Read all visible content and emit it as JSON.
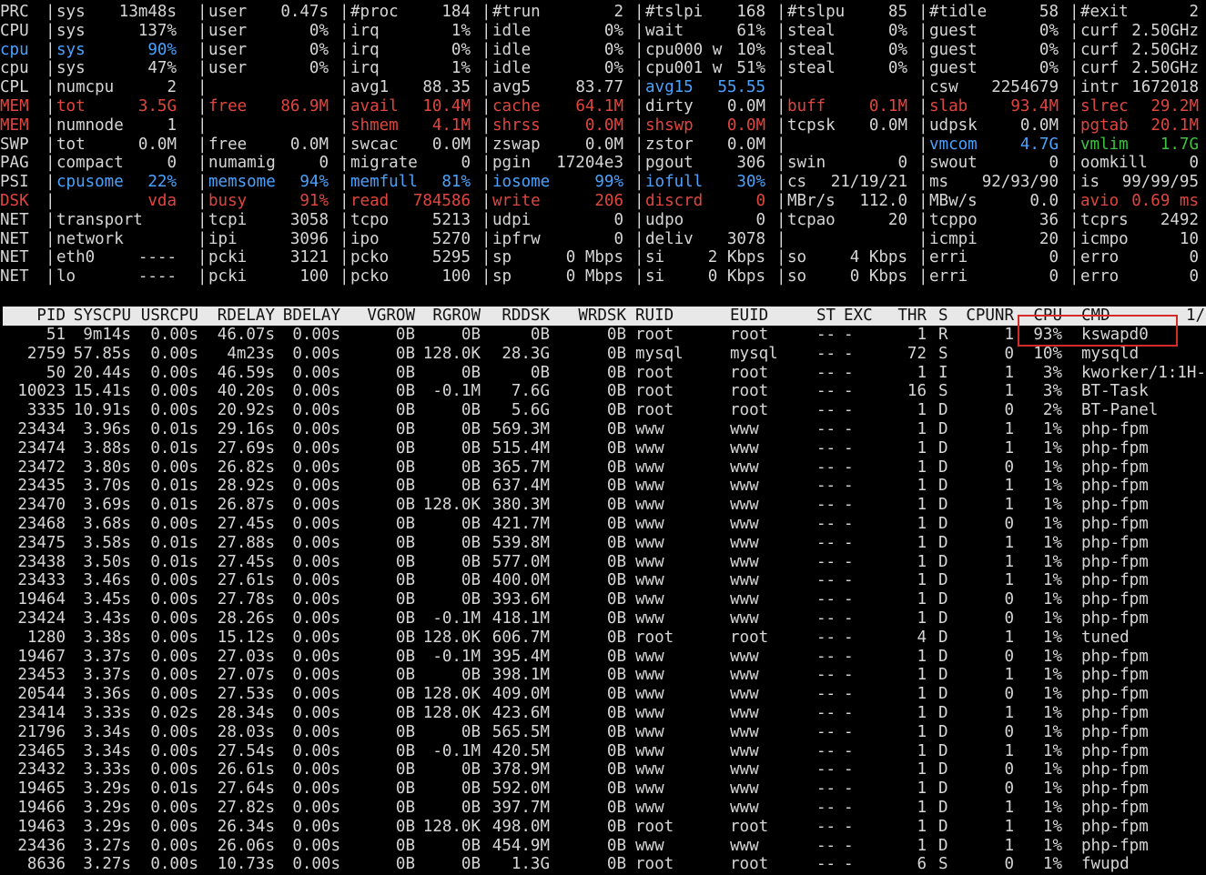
{
  "system_rows": [
    {
      "label": "PRC",
      "cells": [
        {
          "k": "sys",
          "v": "13m48s"
        },
        {
          "k": "user",
          "v": "0.47s"
        },
        {
          "k": "#proc",
          "v": "184"
        },
        {
          "k": "#trun",
          "v": "2"
        },
        {
          "k": "#tslpi",
          "v": "168"
        },
        {
          "k": "#tslpu",
          "v": "85"
        },
        {
          "k": "#tidle",
          "v": "58"
        },
        {
          "k": "#exit",
          "v": "2"
        }
      ]
    },
    {
      "label": "CPU",
      "cells": [
        {
          "k": "sys",
          "v": "137%"
        },
        {
          "k": "user",
          "v": "0%"
        },
        {
          "k": "irq",
          "v": "1%"
        },
        {
          "k": "idle",
          "v": "0%"
        },
        {
          "k": "wait",
          "v": "61%"
        },
        {
          "k": "steal",
          "v": "0%"
        },
        {
          "k": "guest",
          "v": "0%"
        },
        {
          "k": "curf",
          "v": "2.50GHz"
        }
      ]
    },
    {
      "label": "cpu",
      "color": "blue",
      "cells": [
        {
          "k": "sys",
          "v": "90%",
          "color": "blue"
        },
        {
          "k": "user",
          "v": "0%"
        },
        {
          "k": "irq",
          "v": "0%"
        },
        {
          "k": "idle",
          "v": "0%"
        },
        {
          "k": "cpu000 w",
          "v": "10%"
        },
        {
          "k": "steal",
          "v": "0%"
        },
        {
          "k": "guest",
          "v": "0%"
        },
        {
          "k": "curf",
          "v": "2.50GHz"
        }
      ]
    },
    {
      "label": "cpu",
      "cells": [
        {
          "k": "sys",
          "v": "47%"
        },
        {
          "k": "user",
          "v": "0%"
        },
        {
          "k": "irq",
          "v": "1%"
        },
        {
          "k": "idle",
          "v": "0%"
        },
        {
          "k": "cpu001 w",
          "v": "51%"
        },
        {
          "k": "steal",
          "v": "0%"
        },
        {
          "k": "guest",
          "v": "0%"
        },
        {
          "k": "curf",
          "v": "2.50GHz"
        }
      ]
    },
    {
      "label": "CPL",
      "cells": [
        {
          "k": "numcpu",
          "v": "2"
        },
        {
          "k": "",
          "v": ""
        },
        {
          "k": "avg1",
          "v": "88.35"
        },
        {
          "k": "avg5",
          "v": "83.77"
        },
        {
          "k": "avg15",
          "v": "55.55",
          "color": "blue"
        },
        {
          "k": "",
          "v": ""
        },
        {
          "k": "csw",
          "v": "2254679"
        },
        {
          "k": "intr",
          "v": "1672018"
        }
      ]
    },
    {
      "label": "MEM",
      "color": "red",
      "cells": [
        {
          "k": "tot",
          "v": "3.5G",
          "color": "red"
        },
        {
          "k": "free",
          "v": "86.9M",
          "color": "red"
        },
        {
          "k": "avail",
          "v": "10.4M",
          "color": "red"
        },
        {
          "k": "cache",
          "v": "64.1M",
          "color": "red"
        },
        {
          "k": "dirty",
          "v": "0.0M"
        },
        {
          "k": "buff",
          "v": "0.1M",
          "color": "red"
        },
        {
          "k": "slab",
          "v": "93.4M",
          "color": "red"
        },
        {
          "k": "slrec",
          "v": "29.2M",
          "color": "red"
        }
      ]
    },
    {
      "label": "MEM",
      "color": "red",
      "cells": [
        {
          "k": "numnode",
          "v": "1"
        },
        {
          "k": "",
          "v": ""
        },
        {
          "k": "shmem",
          "v": "4.1M",
          "color": "red"
        },
        {
          "k": "shrss",
          "v": "0.0M",
          "color": "red"
        },
        {
          "k": "shswp",
          "v": "0.0M",
          "color": "red"
        },
        {
          "k": "tcpsk",
          "v": "0.0M"
        },
        {
          "k": "udpsk",
          "v": "0.0M"
        },
        {
          "k": "pgtab",
          "v": "20.1M",
          "color": "red"
        }
      ]
    },
    {
      "label": "SWP",
      "cells": [
        {
          "k": "tot",
          "v": "0.0M"
        },
        {
          "k": "free",
          "v": "0.0M"
        },
        {
          "k": "swcac",
          "v": "0.0M"
        },
        {
          "k": "zswap",
          "v": "0.0M"
        },
        {
          "k": "zstor",
          "v": "0.0M"
        },
        {
          "k": "",
          "v": ""
        },
        {
          "k": "vmcom",
          "v": "4.7G",
          "color": "blue"
        },
        {
          "k": "vmlim",
          "v": "1.7G",
          "color": "green"
        }
      ]
    },
    {
      "label": "PAG",
      "cells": [
        {
          "k": "compact",
          "v": "0"
        },
        {
          "k": "numamig",
          "v": "0"
        },
        {
          "k": "migrate",
          "v": "0"
        },
        {
          "k": "pgin",
          "v": "17204e3"
        },
        {
          "k": "pgout",
          "v": "306"
        },
        {
          "k": "swin",
          "v": "0"
        },
        {
          "k": "swout",
          "v": "0"
        },
        {
          "k": "oomkill",
          "v": "0"
        }
      ]
    },
    {
      "label": "PSI",
      "cells": [
        {
          "k": "cpusome",
          "v": "22%",
          "color": "blue"
        },
        {
          "k": "memsome",
          "v": "94%",
          "color": "blue"
        },
        {
          "k": "memfull",
          "v": "81%",
          "color": "blue"
        },
        {
          "k": "iosome",
          "v": "99%",
          "color": "blue"
        },
        {
          "k": "iofull",
          "v": "30%",
          "color": "blue"
        },
        {
          "k": "cs",
          "v": "21/19/21"
        },
        {
          "k": "ms",
          "v": "92/93/90"
        },
        {
          "k": "is",
          "v": "99/99/95"
        }
      ]
    },
    {
      "label": "DSK",
      "color": "red",
      "cells": [
        {
          "k": "",
          "v": "vda",
          "color": "red"
        },
        {
          "k": "busy",
          "v": "91%",
          "color": "red"
        },
        {
          "k": "read",
          "v": "784586",
          "color": "red"
        },
        {
          "k": "write",
          "v": "206",
          "color": "red"
        },
        {
          "k": "discrd",
          "v": "0",
          "color": "red"
        },
        {
          "k": "MBr/s",
          "v": "112.0"
        },
        {
          "k": "MBw/s",
          "v": "0.0"
        },
        {
          "k": "avio",
          "v": "0.69 ms",
          "color": "red"
        }
      ]
    },
    {
      "label": "NET",
      "cells": [
        {
          "k": "transport",
          "v": ""
        },
        {
          "k": "tcpi",
          "v": "3058"
        },
        {
          "k": "tcpo",
          "v": "5213"
        },
        {
          "k": "udpi",
          "v": "0"
        },
        {
          "k": "udpo",
          "v": "0"
        },
        {
          "k": "tcpao",
          "v": "20"
        },
        {
          "k": "tcppo",
          "v": "36"
        },
        {
          "k": "tcprs",
          "v": "2492"
        }
      ]
    },
    {
      "label": "NET",
      "cells": [
        {
          "k": "network",
          "v": ""
        },
        {
          "k": "ipi",
          "v": "3096"
        },
        {
          "k": "ipo",
          "v": "5270"
        },
        {
          "k": "ipfrw",
          "v": "0"
        },
        {
          "k": "deliv",
          "v": "3078"
        },
        {
          "k": "",
          "v": ""
        },
        {
          "k": "icmpi",
          "v": "20"
        },
        {
          "k": "icmpo",
          "v": "10"
        }
      ]
    },
    {
      "label": "NET",
      "cells": [
        {
          "k": "eth0",
          "v": "----"
        },
        {
          "k": "pcki",
          "v": "3121"
        },
        {
          "k": "pcko",
          "v": "5295"
        },
        {
          "k": "sp",
          "v": "0 Mbps"
        },
        {
          "k": "si",
          "v": "2 Kbps"
        },
        {
          "k": "so",
          "v": "4 Kbps"
        },
        {
          "k": "erri",
          "v": "0"
        },
        {
          "k": "erro",
          "v": "0"
        }
      ]
    },
    {
      "label": "NET",
      "cells": [
        {
          "k": "lo",
          "v": "----"
        },
        {
          "k": "pcki",
          "v": "100"
        },
        {
          "k": "pcko",
          "v": "100"
        },
        {
          "k": "sp",
          "v": "0 Mbps"
        },
        {
          "k": "si",
          "v": "0 Kbps"
        },
        {
          "k": "so",
          "v": "0 Kbps"
        },
        {
          "k": "erri",
          "v": "0"
        },
        {
          "k": "erro",
          "v": "0"
        }
      ]
    }
  ],
  "process_header": {
    "pid": "PID",
    "syscpu": "SYSCPU",
    "usrcpu": "USRCPU",
    "rdelay": "RDELAY",
    "bdelay": "BDELAY",
    "vgrow": "VGROW",
    "rgrow": "RGROW",
    "rddsk": "RDDSK",
    "wrdsk": "WRDSK",
    "ruid": "RUID",
    "euid": "EUID",
    "st": "ST",
    "exc": "EXC",
    "thr": "THR",
    "s": "S",
    "cpunr": "CPUNR",
    "cpu": "CPU",
    "cmd": "CMD",
    "page": "1/"
  },
  "processes": [
    [
      "51",
      "9m14s",
      "0.00s",
      "46.07s",
      "0.00s",
      "0B",
      "0B",
      "0B",
      "0B",
      "root",
      "root",
      "--",
      "-",
      "1",
      "R",
      "1",
      "93%",
      "kswapd0"
    ],
    [
      "2759",
      "57.85s",
      "0.00s",
      "4m23s",
      "0.00s",
      "0B",
      "128.0K",
      "28.3G",
      "0B",
      "mysql",
      "mysql",
      "--",
      "-",
      "72",
      "S",
      "0",
      "10%",
      "mysqld"
    ],
    [
      "50",
      "20.44s",
      "0.00s",
      "46.59s",
      "0.00s",
      "0B",
      "0B",
      "0B",
      "0B",
      "root",
      "root",
      "--",
      "-",
      "1",
      "I",
      "1",
      "3%",
      "kworker/1:1H-"
    ],
    [
      "10023",
      "15.41s",
      "0.00s",
      "40.20s",
      "0.00s",
      "0B",
      "-0.1M",
      "7.6G",
      "0B",
      "root",
      "root",
      "--",
      "-",
      "16",
      "S",
      "1",
      "3%",
      "BT-Task"
    ],
    [
      "3335",
      "10.91s",
      "0.00s",
      "20.92s",
      "0.00s",
      "0B",
      "0B",
      "5.6G",
      "0B",
      "root",
      "root",
      "--",
      "-",
      "1",
      "D",
      "0",
      "2%",
      "BT-Panel"
    ],
    [
      "23434",
      "3.96s",
      "0.01s",
      "29.16s",
      "0.00s",
      "0B",
      "0B",
      "569.3M",
      "0B",
      "www",
      "www",
      "--",
      "-",
      "1",
      "D",
      "1",
      "1%",
      "php-fpm"
    ],
    [
      "23474",
      "3.88s",
      "0.01s",
      "27.69s",
      "0.00s",
      "0B",
      "0B",
      "515.4M",
      "0B",
      "www",
      "www",
      "--",
      "-",
      "1",
      "D",
      "1",
      "1%",
      "php-fpm"
    ],
    [
      "23472",
      "3.80s",
      "0.00s",
      "26.82s",
      "0.00s",
      "0B",
      "0B",
      "365.7M",
      "0B",
      "www",
      "www",
      "--",
      "-",
      "1",
      "D",
      "0",
      "1%",
      "php-fpm"
    ],
    [
      "23435",
      "3.70s",
      "0.01s",
      "28.92s",
      "0.00s",
      "0B",
      "0B",
      "637.4M",
      "0B",
      "www",
      "www",
      "--",
      "-",
      "1",
      "D",
      "1",
      "1%",
      "php-fpm"
    ],
    [
      "23470",
      "3.69s",
      "0.01s",
      "26.87s",
      "0.00s",
      "0B",
      "128.0K",
      "380.3M",
      "0B",
      "www",
      "www",
      "--",
      "-",
      "1",
      "D",
      "1",
      "1%",
      "php-fpm"
    ],
    [
      "23468",
      "3.68s",
      "0.00s",
      "27.45s",
      "0.00s",
      "0B",
      "0B",
      "421.7M",
      "0B",
      "www",
      "www",
      "--",
      "-",
      "1",
      "D",
      "0",
      "1%",
      "php-fpm"
    ],
    [
      "23475",
      "3.58s",
      "0.01s",
      "27.88s",
      "0.00s",
      "0B",
      "0B",
      "539.8M",
      "0B",
      "www",
      "www",
      "--",
      "-",
      "1",
      "D",
      "1",
      "1%",
      "php-fpm"
    ],
    [
      "23438",
      "3.50s",
      "0.01s",
      "27.45s",
      "0.00s",
      "0B",
      "0B",
      "577.0M",
      "0B",
      "www",
      "www",
      "--",
      "-",
      "1",
      "D",
      "1",
      "1%",
      "php-fpm"
    ],
    [
      "23433",
      "3.46s",
      "0.00s",
      "27.61s",
      "0.00s",
      "0B",
      "0B",
      "400.0M",
      "0B",
      "www",
      "www",
      "--",
      "-",
      "1",
      "D",
      "1",
      "1%",
      "php-fpm"
    ],
    [
      "19464",
      "3.45s",
      "0.00s",
      "27.78s",
      "0.00s",
      "0B",
      "0B",
      "393.6M",
      "0B",
      "www",
      "www",
      "--",
      "-",
      "1",
      "D",
      "0",
      "1%",
      "php-fpm"
    ],
    [
      "23424",
      "3.43s",
      "0.00s",
      "28.26s",
      "0.00s",
      "0B",
      "-0.1M",
      "418.1M",
      "0B",
      "www",
      "www",
      "--",
      "-",
      "1",
      "D",
      "0",
      "1%",
      "php-fpm"
    ],
    [
      "1280",
      "3.38s",
      "0.00s",
      "15.12s",
      "0.00s",
      "0B",
      "128.0K",
      "606.7M",
      "0B",
      "root",
      "root",
      "--",
      "-",
      "4",
      "D",
      "1",
      "1%",
      "tuned"
    ],
    [
      "19467",
      "3.37s",
      "0.00s",
      "27.03s",
      "0.00s",
      "0B",
      "-0.1M",
      "395.4M",
      "0B",
      "www",
      "www",
      "--",
      "-",
      "1",
      "D",
      "0",
      "1%",
      "php-fpm"
    ],
    [
      "23453",
      "3.37s",
      "0.00s",
      "27.07s",
      "0.00s",
      "0B",
      "0B",
      "398.1M",
      "0B",
      "www",
      "www",
      "--",
      "-",
      "1",
      "D",
      "1",
      "1%",
      "php-fpm"
    ],
    [
      "20544",
      "3.36s",
      "0.00s",
      "27.53s",
      "0.00s",
      "0B",
      "128.0K",
      "409.0M",
      "0B",
      "www",
      "www",
      "--",
      "-",
      "1",
      "D",
      "0",
      "1%",
      "php-fpm"
    ],
    [
      "23414",
      "3.33s",
      "0.02s",
      "28.34s",
      "0.00s",
      "0B",
      "128.0K",
      "423.6M",
      "0B",
      "www",
      "www",
      "--",
      "-",
      "1",
      "D",
      "1",
      "1%",
      "php-fpm"
    ],
    [
      "21796",
      "3.34s",
      "0.00s",
      "28.03s",
      "0.00s",
      "0B",
      "0B",
      "565.5M",
      "0B",
      "www",
      "www",
      "--",
      "-",
      "1",
      "D",
      "0",
      "1%",
      "php-fpm"
    ],
    [
      "23465",
      "3.34s",
      "0.00s",
      "27.54s",
      "0.00s",
      "0B",
      "-0.1M",
      "420.5M",
      "0B",
      "www",
      "www",
      "--",
      "-",
      "1",
      "D",
      "1",
      "1%",
      "php-fpm"
    ],
    [
      "23432",
      "3.33s",
      "0.00s",
      "26.61s",
      "0.00s",
      "0B",
      "0B",
      "378.9M",
      "0B",
      "www",
      "www",
      "--",
      "-",
      "1",
      "D",
      "0",
      "1%",
      "php-fpm"
    ],
    [
      "19465",
      "3.29s",
      "0.01s",
      "27.64s",
      "0.00s",
      "0B",
      "0B",
      "592.0M",
      "0B",
      "www",
      "www",
      "--",
      "-",
      "1",
      "D",
      "0",
      "1%",
      "php-fpm"
    ],
    [
      "19466",
      "3.29s",
      "0.00s",
      "27.82s",
      "0.00s",
      "0B",
      "0B",
      "397.7M",
      "0B",
      "www",
      "www",
      "--",
      "-",
      "1",
      "D",
      "1",
      "1%",
      "php-fpm"
    ],
    [
      "19463",
      "3.29s",
      "0.00s",
      "26.34s",
      "0.00s",
      "0B",
      "128.0K",
      "498.0M",
      "0B",
      "root",
      "root",
      "--",
      "-",
      "1",
      "D",
      "1",
      "1%",
      "php-fpm"
    ],
    [
      "23436",
      "3.27s",
      "0.00s",
      "26.06s",
      "0.00s",
      "0B",
      "0B",
      "454.9M",
      "0B",
      "www",
      "www",
      "--",
      "-",
      "1",
      "D",
      "1",
      "1%",
      "php-fpm"
    ],
    [
      "8636",
      "3.27s",
      "0.00s",
      "10.73s",
      "0.00s",
      "0B",
      "0B",
      "1.3G",
      "0B",
      "root",
      "root",
      "--",
      "-",
      "6",
      "S",
      "0",
      "1%",
      "fwupd"
    ]
  ],
  "highlight": {
    "color": "#d42a2a",
    "process": "kswapd0",
    "cpu": "93%"
  },
  "colors": {
    "background": "#000000",
    "text": "#d6d6d6",
    "red": "#e0463e",
    "blue": "#4aa2ff",
    "green": "#3ec43e",
    "header_bg": "#e8e8e8"
  }
}
